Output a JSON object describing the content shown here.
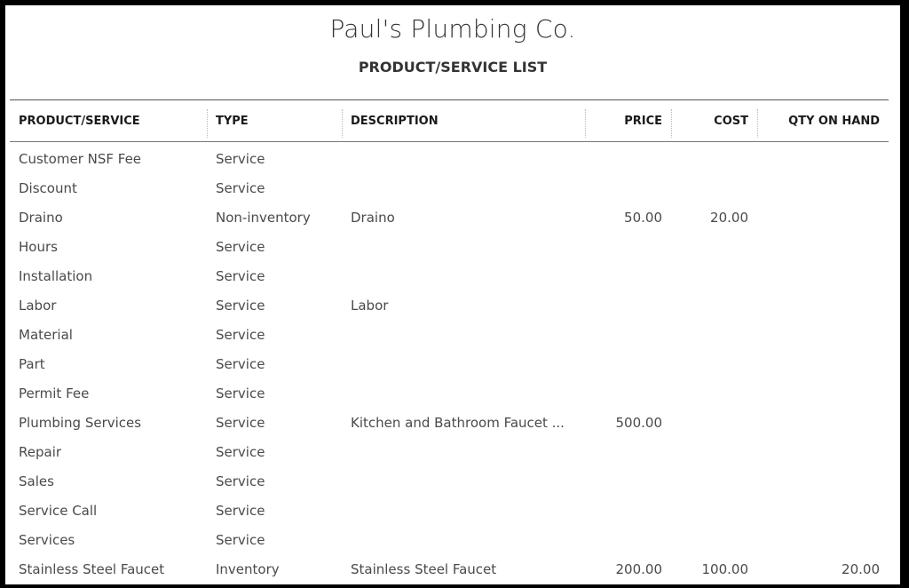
{
  "report": {
    "company_name": "Paul's Plumbing Co.",
    "title": "PRODUCT/SERVICE LIST"
  },
  "table": {
    "columns": {
      "product_service": "PRODUCT/SERVICE",
      "type": "TYPE",
      "description": "DESCRIPTION",
      "price": "PRICE",
      "cost": "COST",
      "qty_on_hand": "QTY ON HAND"
    },
    "rows": [
      {
        "name": "Customer NSF Fee",
        "type": "Service",
        "description": "",
        "price": "",
        "cost": "",
        "qty": ""
      },
      {
        "name": "Discount",
        "type": "Service",
        "description": "",
        "price": "",
        "cost": "",
        "qty": ""
      },
      {
        "name": "Draino",
        "type": "Non-inventory",
        "description": "Draino",
        "price": "50.00",
        "cost": "20.00",
        "qty": ""
      },
      {
        "name": "Hours",
        "type": "Service",
        "description": "",
        "price": "",
        "cost": "",
        "qty": ""
      },
      {
        "name": "Installation",
        "type": "Service",
        "description": "",
        "price": "",
        "cost": "",
        "qty": ""
      },
      {
        "name": "Labor",
        "type": "Service",
        "description": "Labor",
        "price": "",
        "cost": "",
        "qty": ""
      },
      {
        "name": "Material",
        "type": "Service",
        "description": "",
        "price": "",
        "cost": "",
        "qty": ""
      },
      {
        "name": "Part",
        "type": "Service",
        "description": "",
        "price": "",
        "cost": "",
        "qty": ""
      },
      {
        "name": "Permit Fee",
        "type": "Service",
        "description": "",
        "price": "",
        "cost": "",
        "qty": ""
      },
      {
        "name": "Plumbing Services",
        "type": "Service",
        "description": "Kitchen and Bathroom Faucet ...",
        "price": "500.00",
        "cost": "",
        "qty": ""
      },
      {
        "name": "Repair",
        "type": "Service",
        "description": "",
        "price": "",
        "cost": "",
        "qty": ""
      },
      {
        "name": "Sales",
        "type": "Service",
        "description": "",
        "price": "",
        "cost": "",
        "qty": ""
      },
      {
        "name": "Service Call",
        "type": "Service",
        "description": "",
        "price": "",
        "cost": "",
        "qty": ""
      },
      {
        "name": "Services",
        "type": "Service",
        "description": "",
        "price": "",
        "cost": "",
        "qty": ""
      },
      {
        "name": "Stainless Steel Faucet",
        "type": "Inventory",
        "description": "Stainless Steel Faucet",
        "price": "200.00",
        "cost": "100.00",
        "qty": "20.00"
      }
    ]
  }
}
